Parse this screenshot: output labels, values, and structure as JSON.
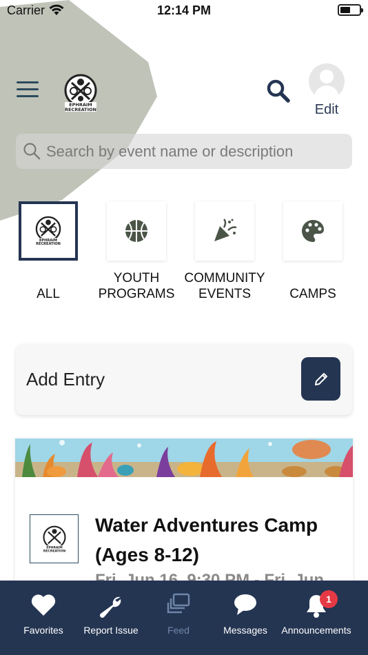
{
  "status_bar": {
    "carrier": "Carrier",
    "time": "12:14 PM"
  },
  "header": {
    "logo_text": "EPHRAIM RECREATION",
    "edit_label": "Edit"
  },
  "search": {
    "placeholder": "Search by event name or description"
  },
  "categories": [
    {
      "label": "ALL",
      "icon": "ephraim-recreation-logo",
      "selected": true
    },
    {
      "label": "YOUTH PROGRAMS",
      "icon": "basketball-icon",
      "selected": false
    },
    {
      "label": "COMMUNITY EVENTS",
      "icon": "party-popper-icon",
      "selected": false
    },
    {
      "label": "CAMPS",
      "icon": "palette-icon",
      "selected": false
    }
  ],
  "add_entry": {
    "label": "Add Entry"
  },
  "event": {
    "title": "Water Adventures Camp (Ages 8-12)",
    "date": "Fri, Jun 16, 9:30 PM - Fri, Jun"
  },
  "tab_bar": {
    "items": [
      {
        "label": "Favorites",
        "icon": "heart-icon"
      },
      {
        "label": "Report Issue",
        "icon": "wrench-icon"
      },
      {
        "label": "Feed",
        "icon": "feed-icon",
        "active": true
      },
      {
        "label": "Messages",
        "icon": "chat-bubble-icon"
      },
      {
        "label": "Announcements",
        "icon": "bell-icon",
        "badge": "1"
      }
    ]
  },
  "colors": {
    "navy": "#243552",
    "accent_shape": "#b9bdb0",
    "icon_dark": "#4a5548",
    "badge_red": "#e53945"
  }
}
